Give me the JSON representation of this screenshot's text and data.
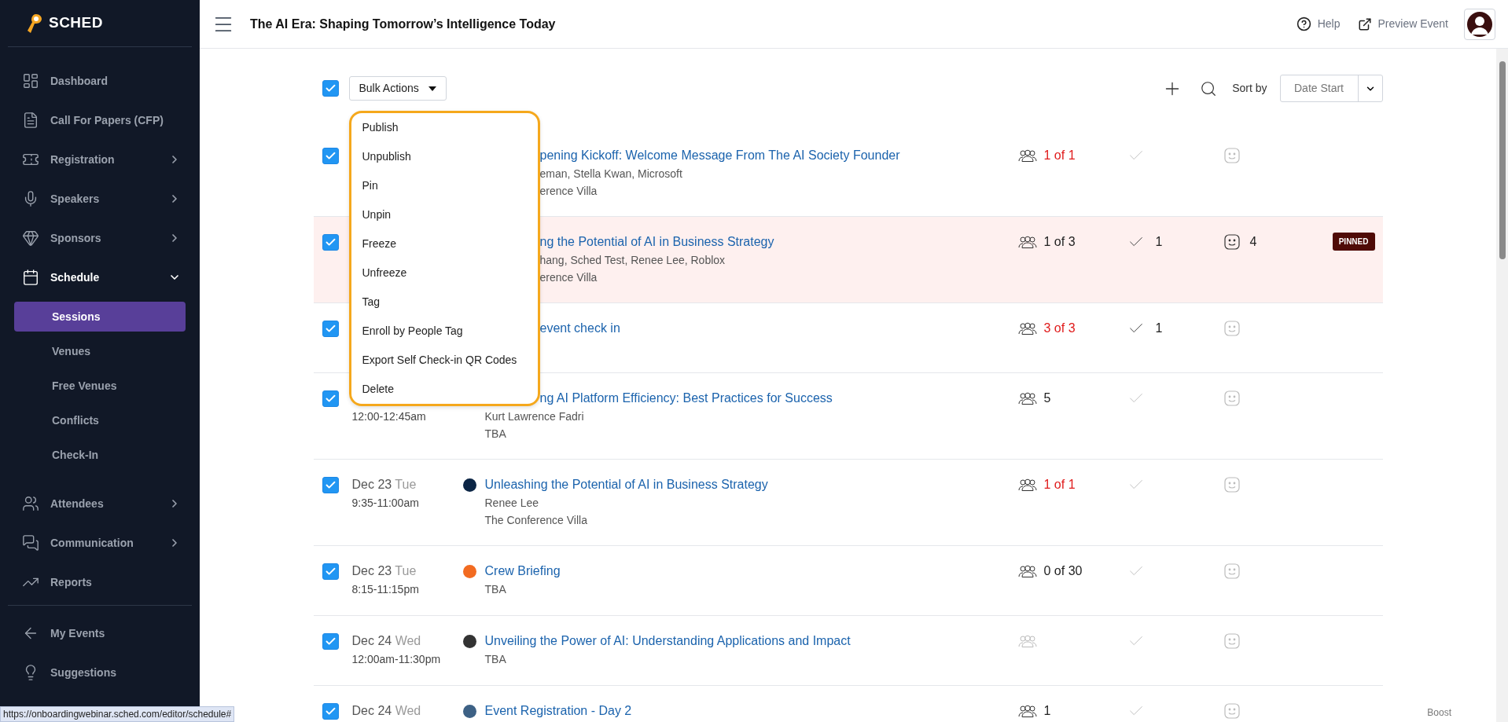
{
  "sidebar": {
    "logo": "SCHED",
    "items": [
      {
        "label": "Dashboard"
      },
      {
        "label": "Call For Papers (CFP)"
      },
      {
        "label": "Registration",
        "expanded": false
      },
      {
        "label": "Speakers",
        "expanded": false
      },
      {
        "label": "Sponsors",
        "expanded": false
      },
      {
        "label": "Schedule",
        "expanded": true,
        "children": [
          {
            "label": "Sessions",
            "selected": true
          },
          {
            "label": "Venues",
            "selected": false
          },
          {
            "label": "Free Venues",
            "selected": false
          },
          {
            "label": "Conflicts",
            "selected": false
          },
          {
            "label": "Check-In",
            "selected": false
          }
        ]
      },
      {
        "label": "Attendees",
        "expanded": false
      },
      {
        "label": "Communication",
        "expanded": false
      },
      {
        "label": "Reports"
      }
    ],
    "footer_items": [
      {
        "label": "My Events"
      },
      {
        "label": "Suggestions"
      }
    ]
  },
  "header": {
    "title": "The AI Era: Shaping Tomorrow’s Intelligence Today",
    "help": "Help",
    "preview": "Preview Event"
  },
  "toolbar": {
    "select_all": true,
    "bulk_actions": "Bulk Actions",
    "sort_label": "Sort by",
    "sort_value": "Date Start"
  },
  "bulk_menu": {
    "items": [
      "Publish",
      "Unpublish",
      "Pin",
      "Unpin",
      "Freeze",
      "Unfreeze",
      "Tag",
      "Enroll by People Tag",
      "Export Self Check-in QR Codes",
      "Delete"
    ]
  },
  "rows": [
    {
      "checked": true,
      "title": "pening Kickoff: Welcome Message From The AI Society Founder",
      "title_clipped": true,
      "speakers": "eman, Stella Kwan, Microsoft",
      "speakers_clipped": true,
      "venue": "erence Villa",
      "venue_clipped": true,
      "attendance": "1 of 1",
      "attendance_alert": true,
      "pinned": false
    },
    {
      "checked": true,
      "title": "ng the Potential of AI in Business Strategy",
      "title_clipped": true,
      "speakers": "hang, Sched Test, Renee Lee, Roblox",
      "speakers_clipped": true,
      "venue": "erence Villa",
      "venue_clipped": true,
      "attendance": "1 of 3",
      "attendance_alert": false,
      "checkins": "1",
      "rating": "4",
      "pinned": true,
      "badge": "PINNED"
    },
    {
      "checked": true,
      "title": "event check in",
      "title_clipped": true,
      "attendance": "3 of 3",
      "attendance_alert": true,
      "checkins": "1",
      "pinned": false
    },
    {
      "checked": true,
      "time": "12:00-12:45am",
      "title": "ng AI Platform Efficiency: Best Practices for Success",
      "title_clipped": true,
      "speakers": "Kurt Lawrence Fadri",
      "speakers_clipped": false,
      "venue": "TBA",
      "venue_clipped": false,
      "attendance": "5",
      "attendance_alert": false,
      "pinned": false
    },
    {
      "checked": true,
      "date": "Dec 23",
      "day": "Tue",
      "time": "9:35-11:00am",
      "color": "#0b2545",
      "title": "Unleashing the Potential of AI in Business Strategy",
      "title_clipped": false,
      "speakers": "Renee Lee",
      "speakers_clipped": false,
      "venue": "The Conference Villa",
      "venue_clipped": false,
      "attendance": "1 of 1",
      "attendance_alert": true,
      "pinned": false
    },
    {
      "checked": true,
      "date": "Dec 23",
      "day": "Tue",
      "time": "8:15-11:15pm",
      "color": "#f26b21",
      "title": "Crew Briefing",
      "title_clipped": false,
      "venue": "TBA",
      "venue_clipped": false,
      "attendance": "0 of 30",
      "attendance_alert": false,
      "pinned": false
    },
    {
      "checked": true,
      "date": "Dec 24",
      "day": "Wed",
      "time": "12:00am-11:30pm",
      "color": "#333333",
      "title": "Unveiling the Power of AI: Understanding Applications and Impact",
      "title_clipped": false,
      "venue": "TBA",
      "venue_clipped": false,
      "pinned": false
    },
    {
      "checked": true,
      "date": "Dec 24",
      "day": "Wed",
      "color": "#3d6185",
      "title": "Event Registration - Day 2",
      "title_clipped": false,
      "attendance": "1",
      "attendance_alert": false,
      "pinned": false
    }
  ],
  "status_url": "https://onboardingwebinar.sched.com/editor/schedule#",
  "boost": "Boost"
}
